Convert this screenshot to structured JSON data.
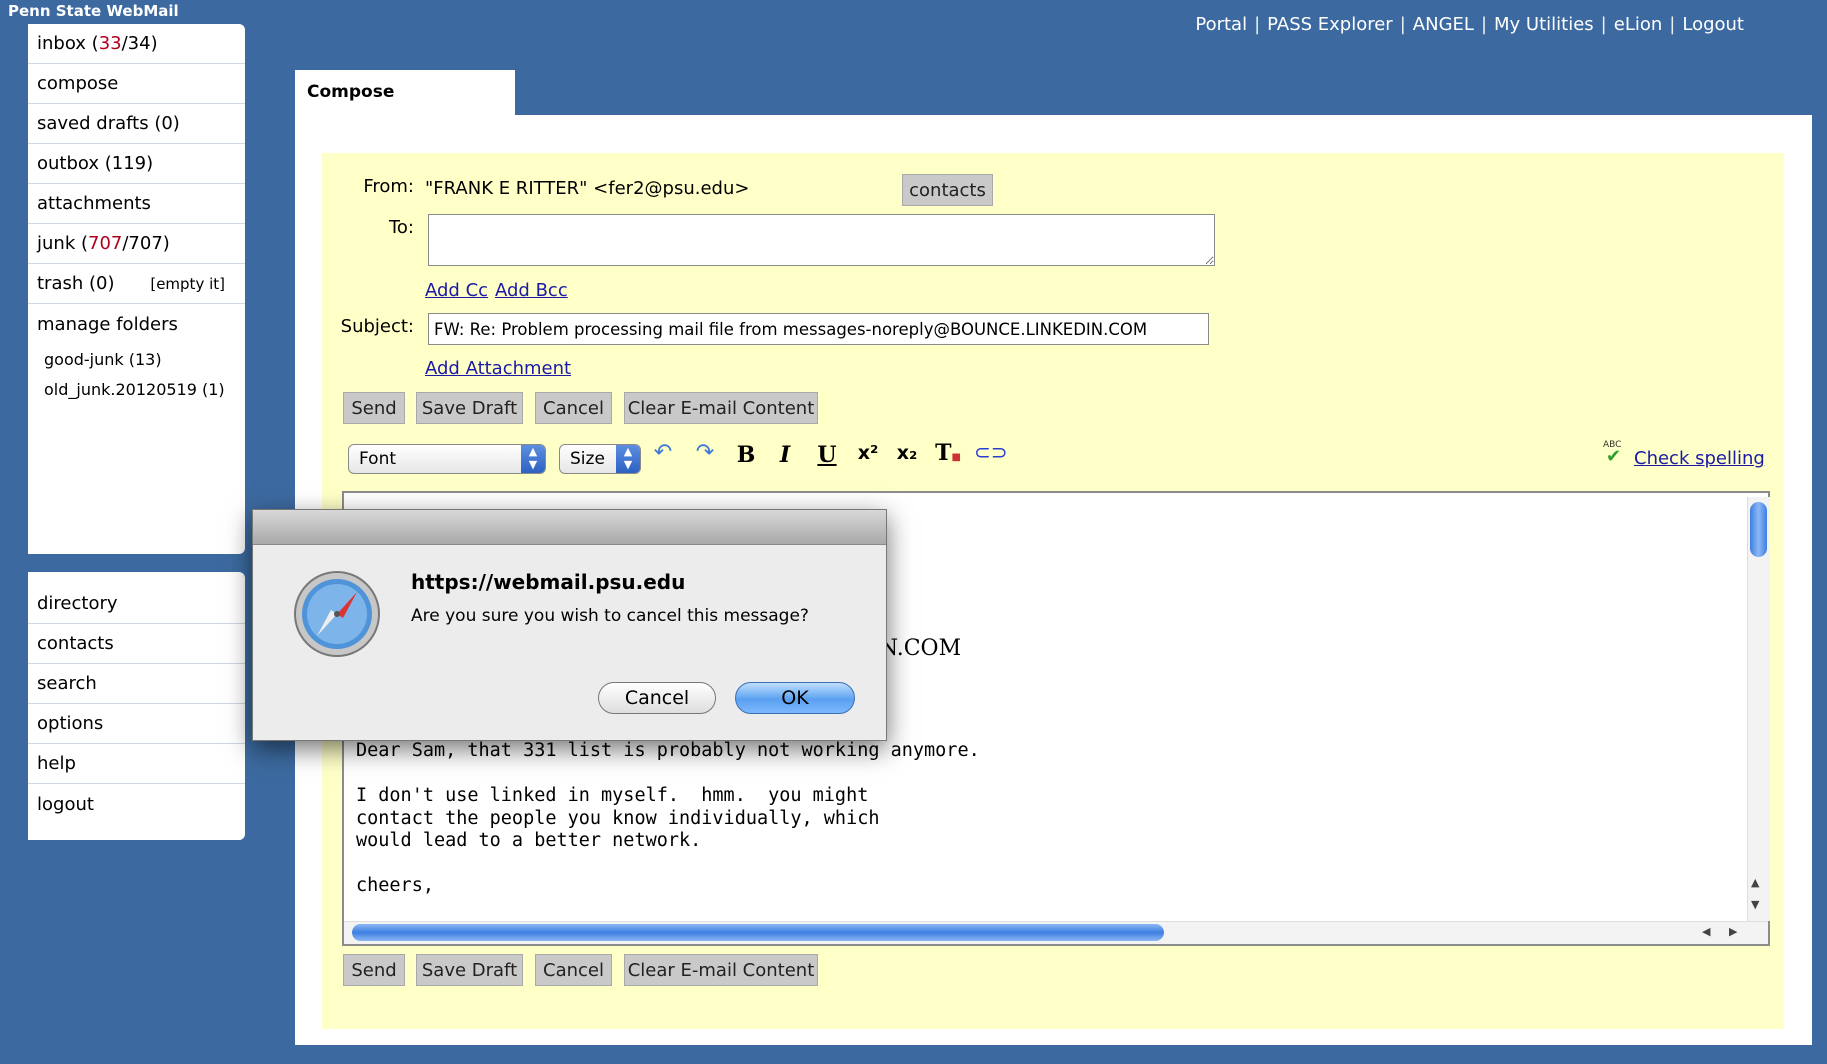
{
  "app": {
    "title": "Penn State WebMail"
  },
  "top_links": [
    "Portal",
    "PASS Explorer",
    "ANGEL",
    "My Utilities",
    "eLion",
    "Logout"
  ],
  "sidebar": {
    "inbox": {
      "label": "inbox",
      "unread": "33",
      "total": "/34)"
    },
    "compose": "compose",
    "saved_drafts": "saved drafts  (0)",
    "outbox": "outbox (119)",
    "attachments": "attachments",
    "junk": {
      "label": "junk",
      "unread": "707",
      "total": "/707)"
    },
    "trash": {
      "label": "trash  (0)",
      "empty": "[empty it]"
    },
    "manage_folders": "manage folders",
    "folders": [
      "good-junk (13)",
      "old_junk.20120519 (1)"
    ],
    "tools": [
      "directory",
      "contacts",
      "search",
      "options",
      "help",
      "logout"
    ]
  },
  "compose": {
    "tab_label": "Compose",
    "from_label": "From:",
    "from_value": "\"FRANK E RITTER\" <fer2@psu.edu>",
    "contacts_button": "contacts",
    "to_label": "To:",
    "to_value": "",
    "add_cc": "Add Cc",
    "add_bcc": "Add Bcc",
    "subject_label": "Subject:",
    "subject_value": "FW: Re: Problem processing mail file from messages-noreply@BOUNCE.LINKEDIN.COM",
    "add_attachment": "Add Attachment",
    "buttons": {
      "send": "Send",
      "save_draft": "Save Draft",
      "cancel": "Cancel",
      "clear": "Clear E-mail Content"
    },
    "toolbar": {
      "font": "Font",
      "size": "Size",
      "check_spelling": "Check spelling",
      "abc": "ABC"
    },
    "editor": {
      "visible_header_fragment": "s-noreply@BOUNCE.LINKEDIN.COM",
      "body": "Dear Sam, that 331 list is probably not working anymore.\n\nI don't use linked in myself.  hmm.  you might\ncontact the people you know individually, which\nwould lead to a better network.\n\ncheers,"
    }
  },
  "dialog": {
    "title": "https://webmail.psu.edu",
    "message": "Are you sure you wish to cancel this message?",
    "cancel": "Cancel",
    "ok": "OK"
  },
  "colors": {
    "background": "#3c6aa0",
    "compose_bg": "#ffffc8",
    "count_red": "#b1001d"
  }
}
